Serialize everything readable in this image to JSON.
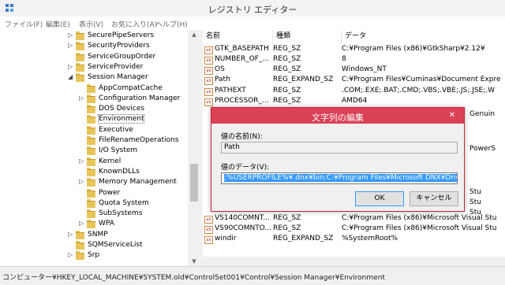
{
  "window": {
    "title": "レジストリ エディター"
  },
  "menu": [
    "ファイル(F)",
    "編集(E)",
    "表示(V)",
    "お気に入り(A)",
    "ヘルプ(H)"
  ],
  "tree": [
    {
      "label": "SecurePipeServers",
      "expandable": true,
      "level": 1
    },
    {
      "label": "SecurityProviders",
      "expandable": true,
      "level": 1
    },
    {
      "label": "ServiceGroupOrder",
      "expandable": false,
      "level": 1
    },
    {
      "label": "ServiceProvider",
      "expandable": true,
      "level": 1
    },
    {
      "label": "Session Manager",
      "expandable": true,
      "expanded": true,
      "level": 1
    },
    {
      "label": "AppCompatCache",
      "expandable": false,
      "level": 2
    },
    {
      "label": "Configuration Manager",
      "expandable": true,
      "level": 2
    },
    {
      "label": "DOS Devices",
      "expandable": false,
      "level": 2
    },
    {
      "label": "Environment",
      "expandable": false,
      "level": 2,
      "selected": true
    },
    {
      "label": "Executive",
      "expandable": false,
      "level": 2
    },
    {
      "label": "FileRenameOperations",
      "expandable": false,
      "level": 2
    },
    {
      "label": "I/O System",
      "expandable": false,
      "level": 2
    },
    {
      "label": "Kernel",
      "expandable": true,
      "level": 2
    },
    {
      "label": "KnownDLLs",
      "expandable": false,
      "level": 2
    },
    {
      "label": "Memory Management",
      "expandable": true,
      "level": 2
    },
    {
      "label": "Power",
      "expandable": false,
      "level": 2
    },
    {
      "label": "Quota System",
      "expandable": false,
      "level": 2
    },
    {
      "label": "SubSystems",
      "expandable": false,
      "level": 2
    },
    {
      "label": "WPA",
      "expandable": true,
      "level": 2
    },
    {
      "label": "SNMP",
      "expandable": true,
      "level": 1
    },
    {
      "label": "SQMServiceList",
      "expandable": false,
      "level": 1
    },
    {
      "label": "Srp",
      "expandable": true,
      "level": 1
    }
  ],
  "columns": [
    "名前",
    "種類",
    "データ"
  ],
  "values": [
    [
      "GTK_BASEPATH",
      "REG_SZ",
      "C:¥Program Files (x86)¥GtkSharp¥2.12¥"
    ],
    [
      "NUMBER_OF_...",
      "REG_SZ",
      "8"
    ],
    [
      "OS",
      "REG_SZ",
      "Windows_NT"
    ],
    [
      "Path",
      "REG_EXPAND_SZ",
      "C:¥Program Files¥Cuminas¥Document Expre"
    ],
    [
      "PATHEXT",
      "REG_SZ",
      ".COM;.EXE;.BAT;.CMD;.VBS;.VBE;.JS;.JSE;.W"
    ],
    [
      "PROCESSOR_...",
      "REG_SZ",
      "AMD64"
    ],
    [
      "VS140COMNT...",
      "REG_SZ",
      "C:¥Program Files (x86)¥Microsoft Visual Stu"
    ],
    [
      "VS90COMNTO...",
      "REG_SZ",
      "C:¥Program Files (x86)¥Microsoft Visual Stu"
    ],
    [
      "windir",
      "REG_EXPAND_SZ",
      "%SystemRoot%"
    ]
  ],
  "hidden_row_fragments": [
    "Genuin",
    "PowerS",
    "Stu",
    "Stu",
    "Stu"
  ],
  "status": "コンピューター¥HKEY_LOCAL_MACHINE¥SYSTEM.old¥ControlSet001¥Control¥Session Manager¥Environment",
  "dialog": {
    "title": "文字列の編集",
    "close": "✕",
    "name_label": "値の名前(N):",
    "name_value": "Path",
    "data_label": "値のデータ(V):",
    "data_value": ";%USERPROFILE%¥.dnx¥bin;C:¥Program Files¥Microsoft DNX¥Dnvm¥",
    "ok": "OK",
    "cancel": "キャンセル"
  },
  "colors": {
    "dialog_title": "#da4155",
    "selection": "#3399ff"
  }
}
